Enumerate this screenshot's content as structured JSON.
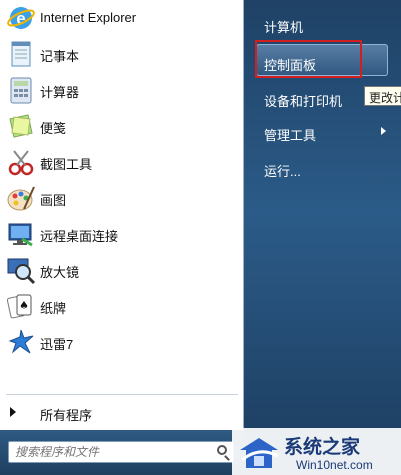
{
  "left_pane": {
    "programs": [
      {
        "label": "Internet Explorer",
        "icon": "internet-explorer-icon"
      },
      {
        "label": "记事本",
        "icon": "notepad-icon"
      },
      {
        "label": "计算器",
        "icon": "calculator-icon"
      },
      {
        "label": "便笺",
        "icon": "sticky-notes-icon"
      },
      {
        "label": "截图工具",
        "icon": "snipping-tool-icon"
      },
      {
        "label": "画图",
        "icon": "paint-icon"
      },
      {
        "label": "远程桌面连接",
        "icon": "remote-desktop-icon"
      },
      {
        "label": "放大镜",
        "icon": "magnifier-icon"
      },
      {
        "label": "纸牌",
        "icon": "solitaire-icon"
      },
      {
        "label": "迅雷7",
        "icon": "thunder-icon"
      }
    ],
    "all_programs": "所有程序"
  },
  "search": {
    "placeholder": "搜索程序和文件"
  },
  "right_pane": {
    "items": [
      {
        "label": "计算机"
      },
      {
        "label": "控制面板"
      },
      {
        "label": "设备和打印机"
      },
      {
        "label": "管理工具"
      },
      {
        "label": "运行..."
      }
    ],
    "tooltip": "更改计"
  },
  "watermark": {
    "title": "系统之家",
    "url": "Win10net.com"
  },
  "colors": {
    "highlight_border": "#d21e1e",
    "right_pane": "#2b5b88"
  }
}
